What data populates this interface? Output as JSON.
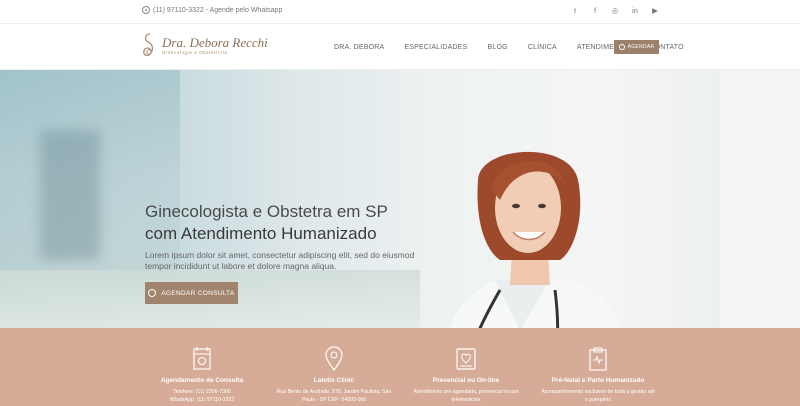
{
  "topbar": {
    "phone_text": "(11) 97110-3322 - Agende pelo Whatsapp",
    "phone_icon": "whatsapp-icon",
    "social": [
      {
        "name": "twitter-icon",
        "glyph": "t"
      },
      {
        "name": "facebook-icon",
        "glyph": "f"
      },
      {
        "name": "instagram-icon",
        "glyph": "◎"
      },
      {
        "name": "linkedin-icon",
        "glyph": "in"
      },
      {
        "name": "youtube-icon",
        "glyph": "▶"
      }
    ]
  },
  "header": {
    "logo_name": "Dra. Debora Recchi",
    "logo_tagline": "Ginecologia e Obstetrícia",
    "nav": [
      "DRA. DEBORA",
      "ESPECIALIDADES",
      "BLOG",
      "CLÍNICA",
      "ATENDIMENTO",
      "CONTATO"
    ],
    "cta_label": "AGENDAR"
  },
  "hero": {
    "headline_line1": "Ginecologista e Obstetra em SP",
    "headline_line2": "com Atendimento Humanizado",
    "subtitle": "Lorem ipsum dolor sit amet, consectetur adipiscing elit, sed do eiusmod tempor incididunt ut labore et dolore magna aliqua.",
    "button_label": "AGENDAR CONSULTA"
  },
  "info": [
    {
      "title": "Agendamento de Consulta",
      "lines": [
        "Telefone: (11) 2306-7300",
        "WhatsApp: (11) 97110-3322"
      ],
      "icon": "calendar-icon"
    },
    {
      "title": "Lalotis Clinic",
      "lines": [
        "Rua Bento de Andrade, 578, Jardim Paulista, São",
        "Paulo - SP CEP: 04503-000"
      ],
      "icon": "location-pin-icon"
    },
    {
      "title": "Presencial ou On-line",
      "lines": [
        "Atendimento pré-agendado, presencial ou por",
        "telemedicina"
      ],
      "icon": "telemedicine-icon"
    },
    {
      "title": "Pré-Natal e Parto Humanizado",
      "lines": [
        "Acompanhamento exclusivo de toda a gestão até",
        "o puerpério"
      ],
      "icon": "clipboard-icon"
    }
  ],
  "colors": {
    "accent": "#9b806b",
    "strip": "#d6ab97"
  }
}
